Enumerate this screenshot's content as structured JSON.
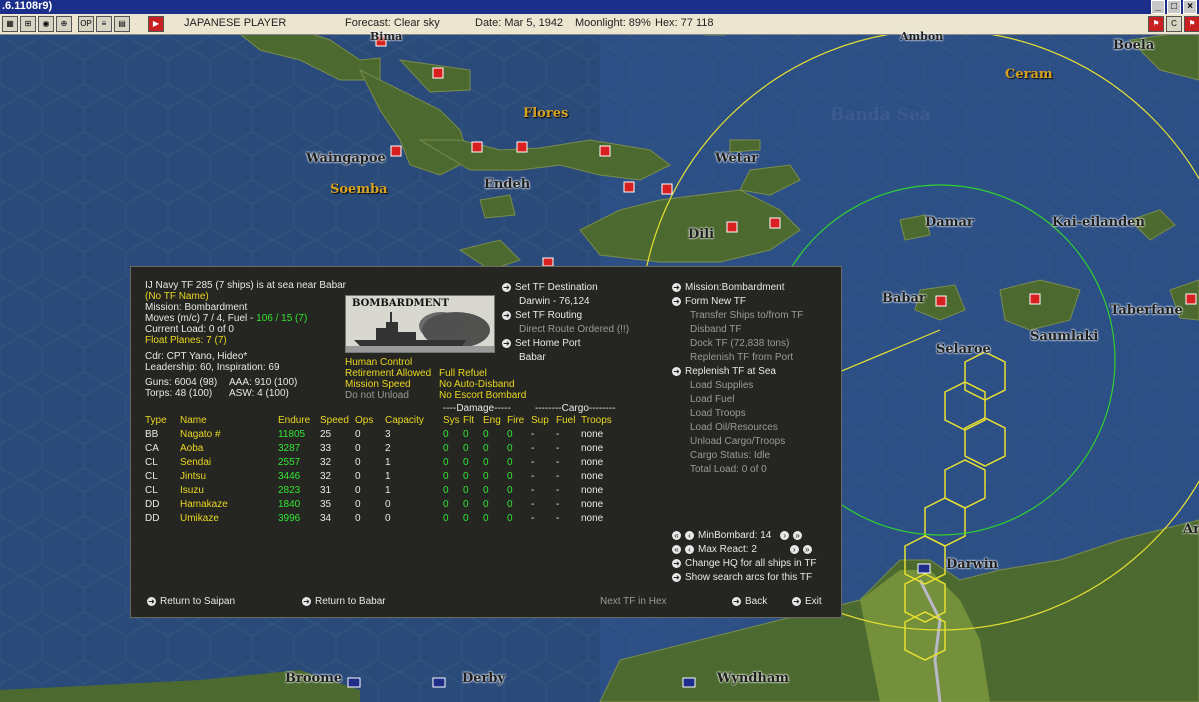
{
  "window": {
    "title": ".6.1108r9)",
    "controls": [
      "_",
      "□",
      "×"
    ]
  },
  "topbar": {
    "player": "JAPANESE PLAYER",
    "forecast": "Forecast: Clear sky",
    "date": "Date: Mar 5, 1942",
    "moonlight": "Moonlight: 89%",
    "hex": "Hex: 77 118",
    "icons": [
      "map-icon",
      "zoom-icon",
      "globe-icon",
      "target-icon",
      "op-icon",
      "list-icon",
      "grid-icon",
      "record-icon",
      "arrow-icon"
    ],
    "left_icon_labels": {
      "op": "OP"
    },
    "right_icons": [
      "flag-icon",
      "close-c-icon",
      "flag2-icon"
    ]
  },
  "map_labels": {
    "bima": "Bima",
    "ambon": "Ambon",
    "boela": "Boela",
    "ceram": "Ceram",
    "flores": "Flores",
    "banda_sea": "Banda Sea",
    "waingapoe": "Waingapoe",
    "soemba": "Soemba",
    "endeh": "Endeh",
    "wetar": "Wetar",
    "dili": "Dili",
    "damar": "Damar",
    "kai": "Kai-eilanden",
    "babar": "Babar",
    "selaroe": "Selaroe",
    "saumlaki": "Saumlaki",
    "taberfane": "Taberfane",
    "darwin": "Darwin",
    "broome": "Broome",
    "derby": "Derby",
    "wyndham": "Wyndham",
    "ar": "Ar"
  },
  "tf": {
    "header": "IJ Navy TF 285 (7 ships) is at sea near Babar",
    "name": "(No TF Name)",
    "mission": "Mission: Bombardment",
    "moves_prefix": "Moves (m/c) 7 / 4, Fuel - ",
    "moves_fuel": "106 / 15 (7)",
    "current_load": "Current Load: 0 of 0",
    "float_planes": "Float Planes: 7 (7)",
    "cdr": "Cdr: CPT Yano, Hideo*",
    "leadership": "Leadership: 60, Inspiration: 69",
    "guns": "Guns: 6004 (98)",
    "aaa": "AAA: 910 (100)",
    "torps": "Torps: 48 (100)",
    "asw": "ASW: 4 (100)",
    "picture_label": "BOMBARDMENT"
  },
  "flags": {
    "human_control": "Human Control",
    "retirement": "Retirement Allowed",
    "mission_speed": "Mission Speed",
    "do_not_unload": "Do not Unload",
    "full_refuel": "Full Refuel",
    "no_auto_disband": "No Auto-Disband",
    "no_escort_bombard": "No Escort Bombard"
  },
  "routing": {
    "set_destination": "Set TF Destination",
    "destination": "Darwin - 76,124",
    "set_routing": "Set TF Routing",
    "direct_route": "Direct Route Ordered (!!)",
    "set_home": "Set Home Port",
    "home": "Babar"
  },
  "right_menu": {
    "mission": "Mission:Bombardment",
    "form_new": "Form New TF",
    "transfer": "Transfer Ships to/from TF",
    "disband": "Disband TF",
    "dock": "Dock TF (72,838 tons)",
    "replenish_port": "Replenish TF from Port",
    "replenish_sea": "Replenish TF at Sea",
    "load_supplies": "Load Supplies",
    "load_fuel": "Load Fuel",
    "load_troops": "Load Troops",
    "load_oil": "Load Oil/Resources",
    "unload": "Unload Cargo/Troops",
    "cargo_status": "Cargo Status: Idle",
    "total_load": "Total Load: 0 of 0",
    "min_bombard": "MinBombard: 14",
    "max_react": "Max React: 2",
    "change_hq": "Change HQ for all ships in TF",
    "show_arcs": "Show search arcs for this TF"
  },
  "table": {
    "damage_group": "----Damage-----",
    "cargo_group": "--------Cargo--------",
    "headers": [
      "Type",
      "Name",
      "Endure",
      "Speed",
      "Ops",
      "Capacity",
      "Sys",
      "Flt",
      "Eng",
      "Fire",
      "Sup",
      "Fuel",
      "Troops"
    ],
    "rows": [
      {
        "type": "BB",
        "name": "Nagato #",
        "endure": "11805",
        "speed": "25",
        "ops": "0",
        "cap": "3",
        "sys": "0",
        "flt": "0",
        "eng": "0",
        "fire": "0",
        "sup": "-",
        "fuel": "-",
        "troops": "none"
      },
      {
        "type": "CA",
        "name": "Aoba",
        "endure": "3287",
        "speed": "33",
        "ops": "0",
        "cap": "2",
        "sys": "0",
        "flt": "0",
        "eng": "0",
        "fire": "0",
        "sup": "-",
        "fuel": "-",
        "troops": "none"
      },
      {
        "type": "CL",
        "name": "Sendai",
        "endure": "2557",
        "speed": "32",
        "ops": "0",
        "cap": "1",
        "sys": "0",
        "flt": "0",
        "eng": "0",
        "fire": "0",
        "sup": "-",
        "fuel": "-",
        "troops": "none"
      },
      {
        "type": "CL",
        "name": "Jintsu",
        "endure": "3446",
        "speed": "32",
        "ops": "0",
        "cap": "1",
        "sys": "0",
        "flt": "0",
        "eng": "0",
        "fire": "0",
        "sup": "-",
        "fuel": "-",
        "troops": "none"
      },
      {
        "type": "CL",
        "name": "Isuzu",
        "endure": "2823",
        "speed": "31",
        "ops": "0",
        "cap": "1",
        "sys": "0",
        "flt": "0",
        "eng": "0",
        "fire": "0",
        "sup": "-",
        "fuel": "-",
        "troops": "none"
      },
      {
        "type": "DD",
        "name": "Hamakaze",
        "endure": "1840",
        "speed": "35",
        "ops": "0",
        "cap": "0",
        "sys": "0",
        "flt": "0",
        "eng": "0",
        "fire": "0",
        "sup": "-",
        "fuel": "-",
        "troops": "none"
      },
      {
        "type": "DD",
        "name": "Umikaze",
        "endure": "3996",
        "speed": "34",
        "ops": "0",
        "cap": "0",
        "sys": "0",
        "flt": "0",
        "eng": "0",
        "fire": "0",
        "sup": "-",
        "fuel": "-",
        "troops": "none"
      }
    ]
  },
  "footer": {
    "return_saipan": "Return to Saipan",
    "return_babar": "Return to Babar",
    "next_tf": "Next TF in Hex",
    "back": "Back",
    "exit": "Exit"
  },
  "colors": {
    "sea": "#2a4a7a",
    "land": "#4c6a30",
    "panel": "#252522",
    "yellow_text": "#e8d820",
    "green_text": "#32e632",
    "title_bar": "#1b2f8a"
  }
}
